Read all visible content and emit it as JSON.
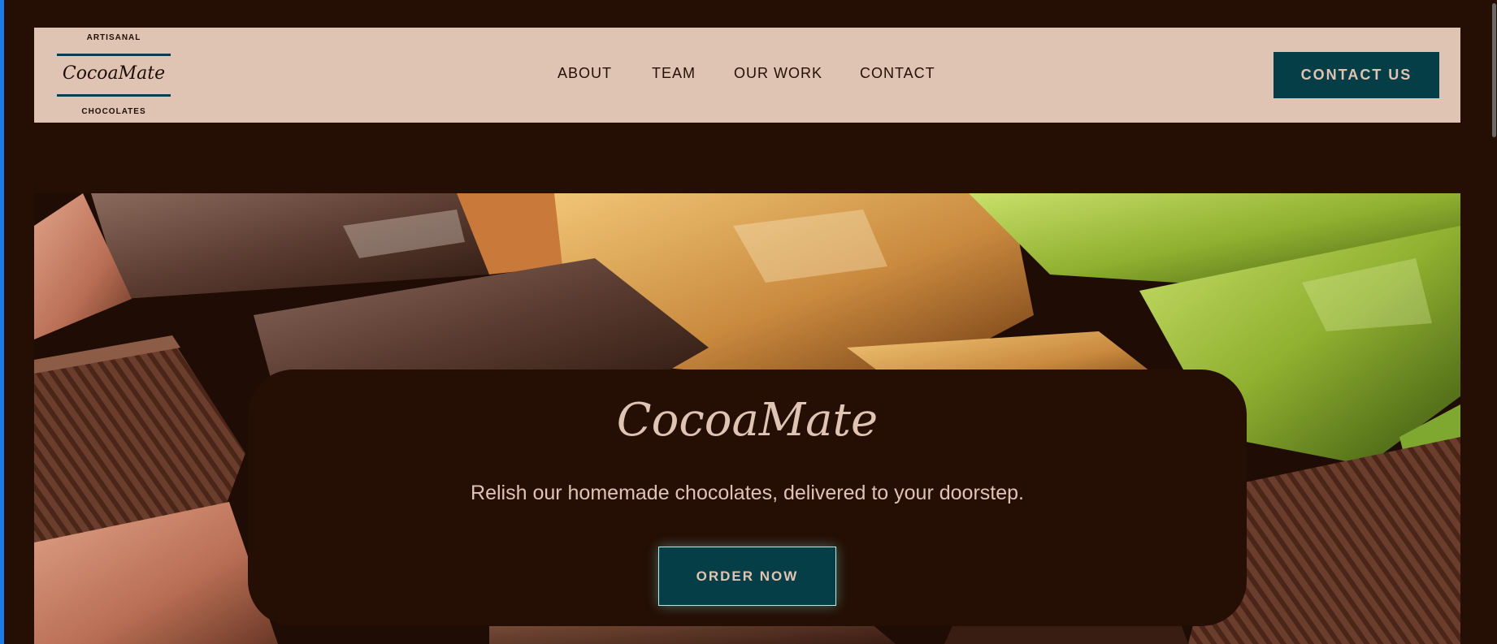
{
  "brand": {
    "logo_top": "ARTISANAL",
    "logo_name": "CocoaMate",
    "logo_bottom": "CHOCOLATES"
  },
  "nav": {
    "links": [
      {
        "label": "ABOUT"
      },
      {
        "label": "TEAM"
      },
      {
        "label": "OUR WORK"
      },
      {
        "label": "CONTACT"
      }
    ],
    "cta_label": "CONTACT US"
  },
  "hero": {
    "title": "CocoaMate",
    "tagline": "Relish our homemade chocolates, delivered to your doorstep.",
    "cta_label": "ORDER NOW"
  },
  "colors": {
    "page_background": "#250e04",
    "navbar_background": "#dfc4b4",
    "button_background": "#063e47",
    "text_light": "#dfc4b4"
  }
}
